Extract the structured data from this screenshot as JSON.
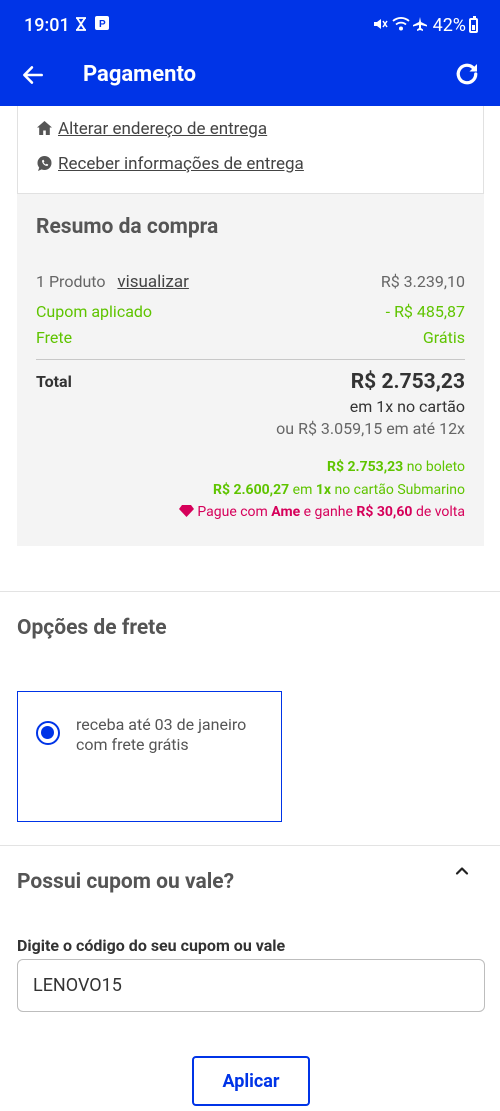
{
  "status_bar": {
    "time": "19:01",
    "battery": "42%",
    "icons": [
      "hourglass-icon",
      "parking-app-icon",
      "mute-icon",
      "wifi-icon",
      "airplane-icon",
      "battery-icon"
    ]
  },
  "app_bar": {
    "title": "Pagamento",
    "colors": {
      "background": "#0034e7",
      "foreground": "#ffffff"
    }
  },
  "address": {
    "change_link": "Alterar endereço de entrega",
    "whatsapp_link": "Receber informações de entrega"
  },
  "summary": {
    "title": "Resumo da compra",
    "product_count": "1 Produto",
    "view_link": "visualizar",
    "product_price": "R$ 3.239,10",
    "coupon_label": "Cupom aplicado",
    "coupon_value": "- R$ 485,87",
    "shipping_label": "Frete",
    "shipping_value": "Grátis",
    "total_label": "Total",
    "total_value": "R$ 2.753,23",
    "total_condition": "em 1x no cartão",
    "installments": "ou R$ 3.059,15 em até 12x",
    "boleto_value": "R$ 2.753,23",
    "boleto_text": "no boleto",
    "card_value": "R$ 2.600,27",
    "card_mid": "em",
    "card_times": "1x",
    "card_text": "no cartão Submarino",
    "ame_prefix": "Pague com",
    "ame_brand": "Ame",
    "ame_mid": "e ganhe",
    "ame_value": "R$ 30,60",
    "ame_suffix": "de volta",
    "colors": {
      "green": "#5fc400",
      "ame": "#d6005a"
    }
  },
  "shipping_options": {
    "title": "Opções de frete",
    "option": "receba até 03 de janeiro com frete grátis",
    "selected": true
  },
  "coupon": {
    "title": "Possui cupom ou vale?",
    "field_label": "Digite o código do seu cupom ou vale",
    "value": "LENOVO15",
    "apply_label": "Aplicar"
  }
}
